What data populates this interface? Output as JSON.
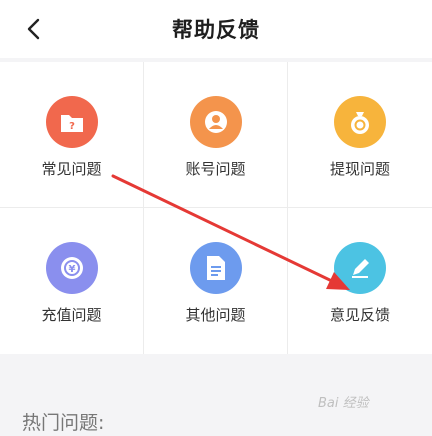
{
  "header": {
    "title": "帮助反馈",
    "back_icon": "chevron-left-icon"
  },
  "categories": [
    {
      "label": "常见问题",
      "icon": "question-folder-icon",
      "color": "#f1684d"
    },
    {
      "label": "账号问题",
      "icon": "user-icon",
      "color": "#f4944c"
    },
    {
      "label": "提现问题",
      "icon": "money-bag-icon",
      "color": "#f7b43c"
    },
    {
      "label": "充值问题",
      "icon": "coin-icon",
      "color": "#8a8fee"
    },
    {
      "label": "其他问题",
      "icon": "document-icon",
      "color": "#6d9bee"
    },
    {
      "label": "意见反馈",
      "icon": "edit-pen-icon",
      "color": "#4cc3e3"
    }
  ],
  "hot_section": {
    "title": "热门问题:"
  },
  "watermark": "Bai 经验",
  "annotation_color": "#e53935"
}
